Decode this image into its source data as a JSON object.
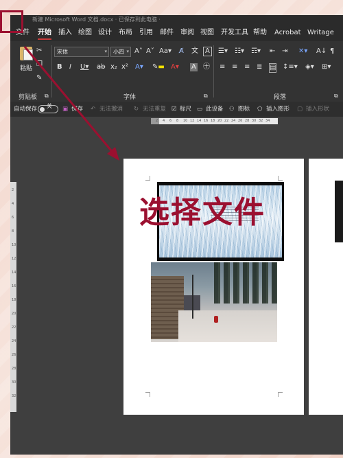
{
  "window": {
    "title": "新建 Microsoft Word 文档.docx · 已保存到此电脑 ·"
  },
  "menu": {
    "items": [
      "文件",
      "开始",
      "插入",
      "绘图",
      "设计",
      "布局",
      "引用",
      "邮件",
      "审阅",
      "视图",
      "开发工具",
      "帮助",
      "Acrobat",
      "Writage"
    ],
    "active": "开始",
    "highlight": "文件"
  },
  "ribbon": {
    "clipboard": {
      "paste_label": "粘贴",
      "group_label": "剪贴板"
    },
    "font": {
      "font_name": "宋体",
      "font_size": "小四",
      "group_label": "字体"
    },
    "paragraph": {
      "group_label": "段落"
    }
  },
  "quickbar": {
    "autosave_label": "自动保存",
    "autosave_state": "关",
    "save_label": "保存",
    "undo_label": "无法撤消",
    "redo_label": "无法重复",
    "ruler_label": "标尺",
    "this_device_label": "此设备",
    "icon_label": "图标",
    "insert_shape_label": "插入图形",
    "insert_shape2_label": "插入形状"
  },
  "ruler": {
    "h_ticks": [
      "2",
      "4",
      "6",
      "8",
      "10",
      "12",
      "14",
      "16",
      "18",
      "20",
      "22",
      "24",
      "26",
      "28",
      "30",
      "32",
      "34"
    ],
    "v_ticks": [
      "2",
      "4",
      "6",
      "8",
      "10",
      "12",
      "14",
      "16",
      "18",
      "20",
      "22",
      "24",
      "26",
      "28",
      "30",
      "32"
    ]
  },
  "overlay": {
    "caption": "选择文件"
  },
  "colors": {
    "accent": "#9b1030",
    "ribbon_bg": "#333333",
    "workspace_bg": "#3f3f3f"
  }
}
